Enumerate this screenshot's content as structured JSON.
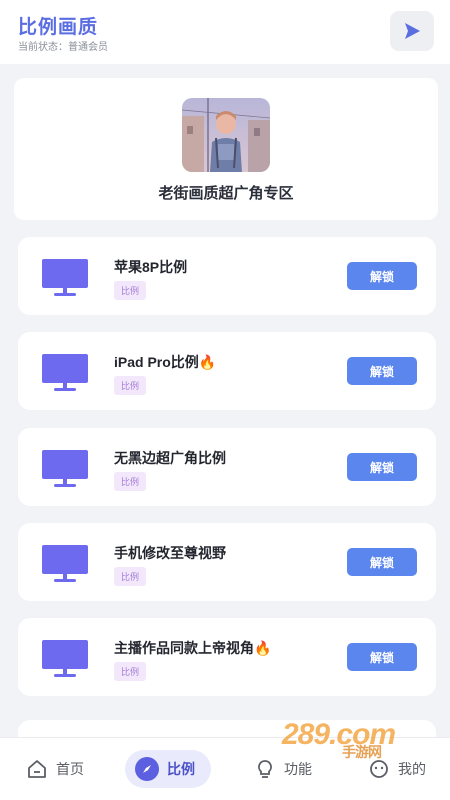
{
  "header": {
    "title": "比例画质",
    "status": "当前状态：普通会员",
    "action_icon": "play-icon"
  },
  "hero": {
    "title": "老街画质超广角专区",
    "image": "anime-character-illustration"
  },
  "cards": [
    {
      "label": "苹果8P比例",
      "tag": "比例",
      "button": "解锁",
      "fire": false
    },
    {
      "label": "iPad Pro比例",
      "tag": "比例",
      "button": "解锁",
      "fire": true
    },
    {
      "label": "无黑边超广角比例",
      "tag": "比例",
      "button": "解锁",
      "fire": false
    },
    {
      "label": "手机修改至尊视野",
      "tag": "比例",
      "button": "解锁",
      "fire": false
    },
    {
      "label": "主播作品同款上帝视角",
      "tag": "比例",
      "button": "解锁",
      "fire": true
    }
  ],
  "tabbar": {
    "home": "首页",
    "ratio": "比例",
    "features": "功能",
    "mine": "我的"
  },
  "watermark": {
    "brand": "289.com",
    "subtitle": "手游网"
  },
  "colors": {
    "accent": "#5b6ee1",
    "button": "#5b86ee",
    "monitor": "#6e6af0",
    "tag_bg": "#f3e8fb",
    "tag_text": "#a27bd6"
  }
}
